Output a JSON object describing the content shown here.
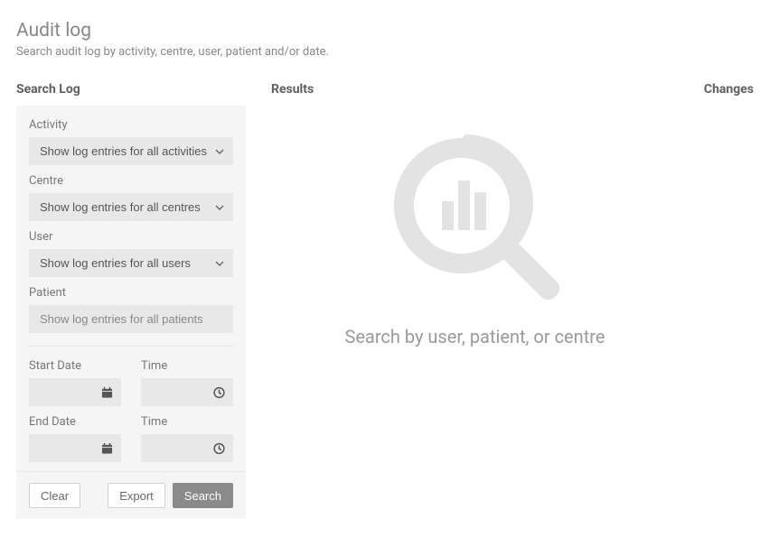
{
  "page": {
    "title": "Audit log",
    "subtitle": "Search audit log by activity, centre, user, patient and/or date."
  },
  "headings": {
    "search": "Search Log",
    "results": "Results",
    "changes": "Changes"
  },
  "filters": {
    "activity": {
      "label": "Activity",
      "selected": "Show log entries for all activities"
    },
    "centre": {
      "label": "Centre",
      "selected": "Show log entries for all centres"
    },
    "user": {
      "label": "User",
      "selected": "Show log entries for all users"
    },
    "patient": {
      "label": "Patient",
      "placeholder": "Show log entries for all patients",
      "value": ""
    },
    "start_date": {
      "label": "Start Date",
      "value": ""
    },
    "start_time": {
      "label": "Time",
      "value": ""
    },
    "end_date": {
      "label": "End Date",
      "value": ""
    },
    "end_time": {
      "label": "Time",
      "value": ""
    }
  },
  "actions": {
    "clear": "Clear",
    "export": "Export",
    "search": "Search"
  },
  "results": {
    "empty_message": "Search by user, patient, or centre"
  }
}
